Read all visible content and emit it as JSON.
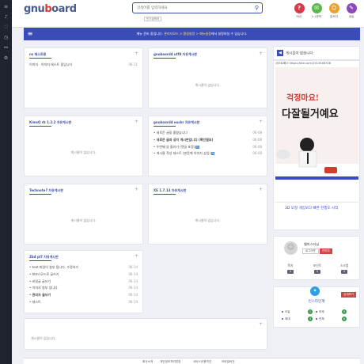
{
  "leftbar": {
    "icons": [
      "menu-icon",
      "bell-icon",
      "heart-icon",
      "clock-icon",
      "link-icon",
      "gear-icon"
    ],
    "glyphs": [
      "≡",
      "♪",
      "♡",
      "◷",
      "⚯",
      "⚙"
    ]
  },
  "header": {
    "logo_prefix": "gnu",
    "logo_o": "b",
    "logo_rest": "oard",
    "search_placeholder": "검색어를 입력하세요",
    "search_icon": "⚲",
    "popular_label": "인기검색어",
    "quick": [
      {
        "label": "FAQ",
        "glyph": "?",
        "color": "#d63a4a"
      },
      {
        "label": "1:1문의",
        "glyph": "✉",
        "color": "#5bb84a"
      },
      {
        "label": "접속자",
        "glyph": "☺",
        "color": "#e9a12b"
      },
      {
        "label": "새글",
        "glyph": "✎",
        "color": "#8a4ab8"
      }
    ]
  },
  "nav": {
    "menu_glyph": "≡",
    "notice_a": "메뉴 준비 중입니다. ",
    "notice_b": "관리자모드 > 환경설정 > 메뉴설정",
    "notice_c": "에서 설정하실 수 있습니다."
  },
  "boards": [
    {
      "title": "ns 테스트용",
      "plus": "+",
      "posts": [
        {
          "title": "이미지 · 이미지 테스트 중입니다",
          "date": "06-11"
        }
      ]
    },
    {
      "title": "gnuboard4 utf8 자유게시판",
      "plus": "+",
      "empty": "게시물이 없습니다."
    },
    {
      "title": "KimsQ rb 1.2.2 자유게시판",
      "plus": "+",
      "empty": "게시물이 없습니다."
    },
    {
      "title": "gnuboard4 euckr 자유게시판",
      "plus": "+",
      "posts": [
        {
          "title": "새로운 글을 올렸습니다",
          "date": "06-08"
        },
        {
          "title": "새로운 글과 공지 게시판입니다 (확인필요)",
          "date": "06-08",
          "bold": true
        },
        {
          "title": "두번째 글 올리기 (댓글 포함)",
          "date": "06-08",
          "badge": "N"
        },
        {
          "title": "게시물 작성 테스트 (본문에 이미지 삽입)",
          "date": "06-08",
          "badge": "N"
        }
      ]
    },
    {
      "title": "Technote7 자유게시판",
      "plus": "+",
      "empty": "게시물이 없습니다."
    },
    {
      "title": "XE 1.7.13 자유게시판",
      "plus": "+",
      "empty": "게시물이 없습니다."
    },
    {
      "title": "Zb4 pl7 자유게시판",
      "plus": "+",
      "posts": [
        {
          "title": "text 파일이 첨부 됩니다. 수정하기",
          "date": "06-14"
        },
        {
          "title": "html 모드로 글쓰기",
          "date": "06-14"
        },
        {
          "title": "비밀글 글쓰기",
          "date": "06-14"
        },
        {
          "title": "이미지 첨부 입니다",
          "date": "06-14"
        },
        {
          "title": "관리자 글쓰기",
          "date": "06-14",
          "bold": true
        },
        {
          "title": "테스트",
          "date": "06-14"
        }
      ]
    },
    {
      "title": "",
      "plus": "+",
      "empty": "게시물이 없습니다."
    }
  ],
  "right": {
    "notice": {
      "label": "게시물이 없습니다.",
      "bell_glyph": "◀"
    },
    "ad": {
      "url": "사이트배너 https://site.com/1513548708",
      "line1": "걱정마요!",
      "line2": "다잘될거예요",
      "banner": "3D 모형 게임보다 빠른 진행도 시작"
    },
    "profile": {
      "avatar_glyph": "☺",
      "name": "웹마스터님",
      "btn_logout": "로그아웃",
      "btn_admin": "관리자",
      "stats": [
        {
          "label": "쪽지",
          "value": "0"
        },
        {
          "label": "포인트",
          "value": "0"
        },
        {
          "label": "스크랩",
          "value": "0"
        }
      ]
    },
    "visitors": {
      "bird_glyph": "✦",
      "title": "인스타인계",
      "btn": "상세보기",
      "cells": [
        {
          "label": "오늘",
          "value": "1"
        },
        {
          "label": "어제",
          "value": "0"
        },
        {
          "label": "최대",
          "value": "3"
        },
        {
          "label": "전체",
          "value": "6"
        }
      ]
    }
  },
  "footer": {
    "links": [
      "회사소개",
      "개인정보처리방침",
      "서비스이용약관",
      "모바일버전"
    ]
  }
}
